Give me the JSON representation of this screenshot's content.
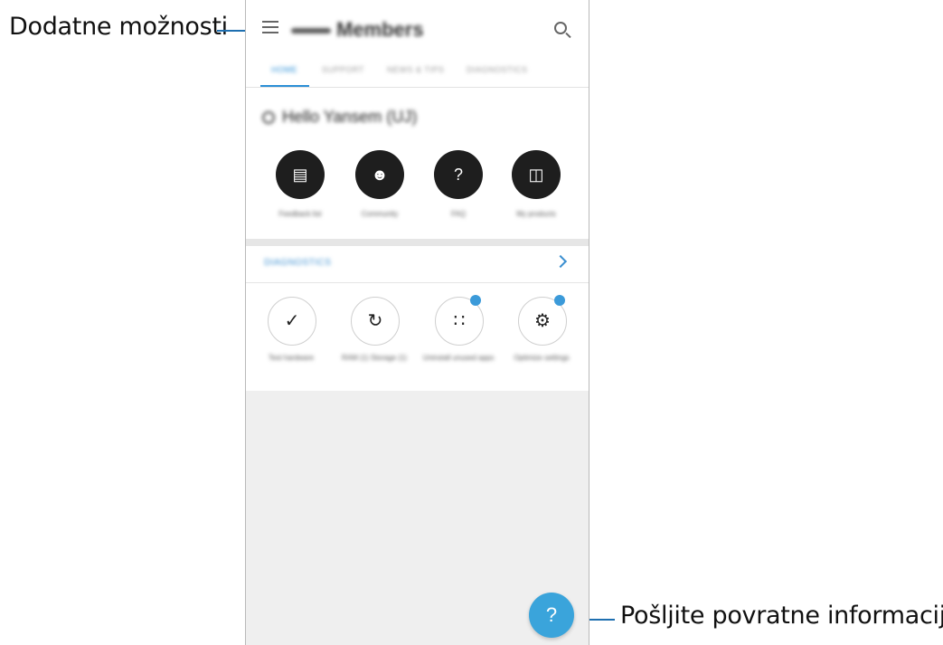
{
  "callouts": {
    "left_label": "Dodatne možnosti",
    "right_label": "Pošljite povratne informacije."
  },
  "app": {
    "title": "Members",
    "tabs": [
      {
        "label": "HOME",
        "active": true
      },
      {
        "label": "SUPPORT",
        "active": false
      },
      {
        "label": "NEWS & TIPS",
        "active": false
      },
      {
        "label": "DIAGNOSTICS",
        "active": false
      }
    ],
    "greeting": "Hello Yansem (UJ)",
    "quick_actions": [
      {
        "label": "Feedback list",
        "icon": "document-icon"
      },
      {
        "label": "Community",
        "icon": "people-icon"
      },
      {
        "label": "FAQ",
        "icon": "faq-book-icon"
      },
      {
        "label": "My products",
        "icon": "devices-icon"
      }
    ],
    "diagnostics": {
      "header": "DIAGNOSTICS",
      "items": [
        {
          "label": "Test hardware",
          "icon": "check-icon",
          "badge": false
        },
        {
          "label": "RAM (1) Storage (1)",
          "icon": "refresh-icon",
          "badge": false
        },
        {
          "label": "Uninstall unused apps",
          "icon": "apps-grid-icon",
          "badge": true
        },
        {
          "label": "Optimize settings",
          "icon": "gear-icon",
          "badge": true
        }
      ]
    },
    "fab_symbol": "?"
  },
  "colors": {
    "accent": "#2b8fd6",
    "fab": "#3aa4db",
    "callout_line": "#1e6fb0"
  }
}
